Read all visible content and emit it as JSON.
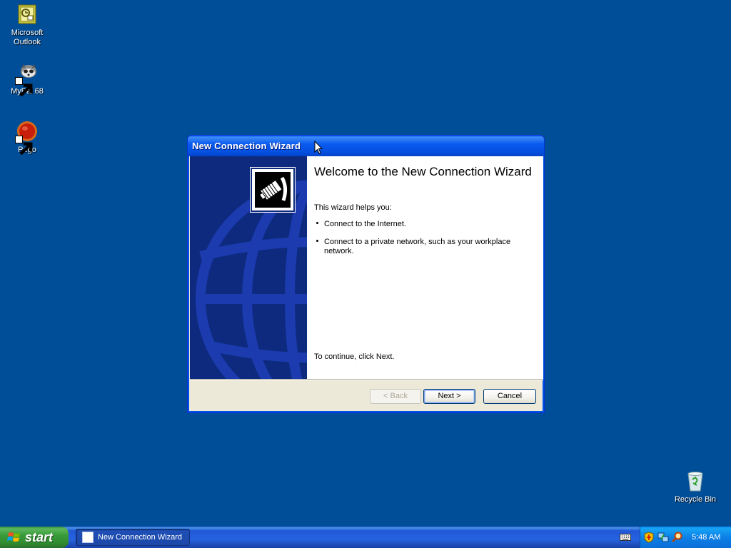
{
  "desktop": {
    "icons": [
      {
        "label": "Microsoft\nOutlook",
        "icon": "outlook-icon"
      },
      {
        "label": "MyPal 68",
        "icon": "mypal-icon"
      },
      {
        "label": "Pego",
        "icon": "pego-icon"
      },
      {
        "label": "Recycle Bin",
        "icon": "recycle-bin-icon"
      }
    ],
    "background_color": "#004e98"
  },
  "wizard": {
    "title": "New Connection Wizard",
    "heading": "Welcome to the New Connection Wizard",
    "intro": "This wizard helps you:",
    "bullets": [
      "Connect to the Internet.",
      "Connect to a private network, such as your workplace network."
    ],
    "continue_text": "To continue, click Next.",
    "buttons": {
      "back": "< Back",
      "next": "Next >",
      "cancel": "Cancel"
    },
    "back_enabled": false,
    "icon": "network-cable-icon"
  },
  "taskbar": {
    "start_label": "start",
    "task_item_label": "New Connection Wizard",
    "clock": "5:48 AM",
    "tray_icons": [
      "security-shield-icon",
      "network-icon",
      "search-icon"
    ]
  }
}
